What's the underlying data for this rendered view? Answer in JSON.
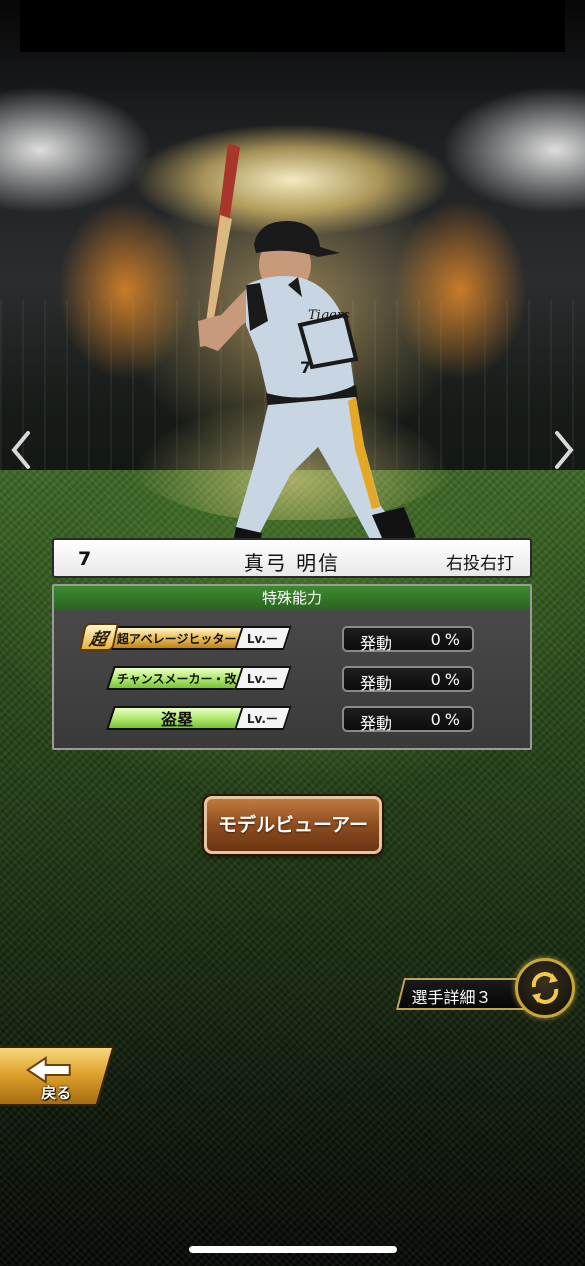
{
  "player": {
    "number": "7",
    "name": "真弓 明信",
    "handedness": "右投右打",
    "team_logo_text": "Tigers"
  },
  "abilities": {
    "header": "特殊能力",
    "chou_badge": "超",
    "items": [
      {
        "label": "超アベレージヒッター",
        "lv": "Lv.ー",
        "status": "発動",
        "percent": "0%",
        "tier": "gold"
      },
      {
        "label": "チャンスメーカー・改",
        "lv": "Lv.ー",
        "status": "発動",
        "percent": "0%",
        "tier": "green"
      },
      {
        "label": "盗塁",
        "lv": "Lv.ー",
        "status": "発動",
        "percent": "0%",
        "tier": "green"
      }
    ]
  },
  "buttons": {
    "model_viewer": "モデルビューアー",
    "player_details": "選手詳細３",
    "back": "戻る"
  },
  "icons": {
    "prev": "chevron-left-icon",
    "next": "chevron-right-icon",
    "switch": "swap-arrows-icon",
    "back": "back-arrow-icon"
  },
  "colors": {
    "ability_header_green": "#2a6420",
    "gold_label": "#e7b84d",
    "green_label": "#aee76a",
    "button_brown": "#8e4d20"
  }
}
